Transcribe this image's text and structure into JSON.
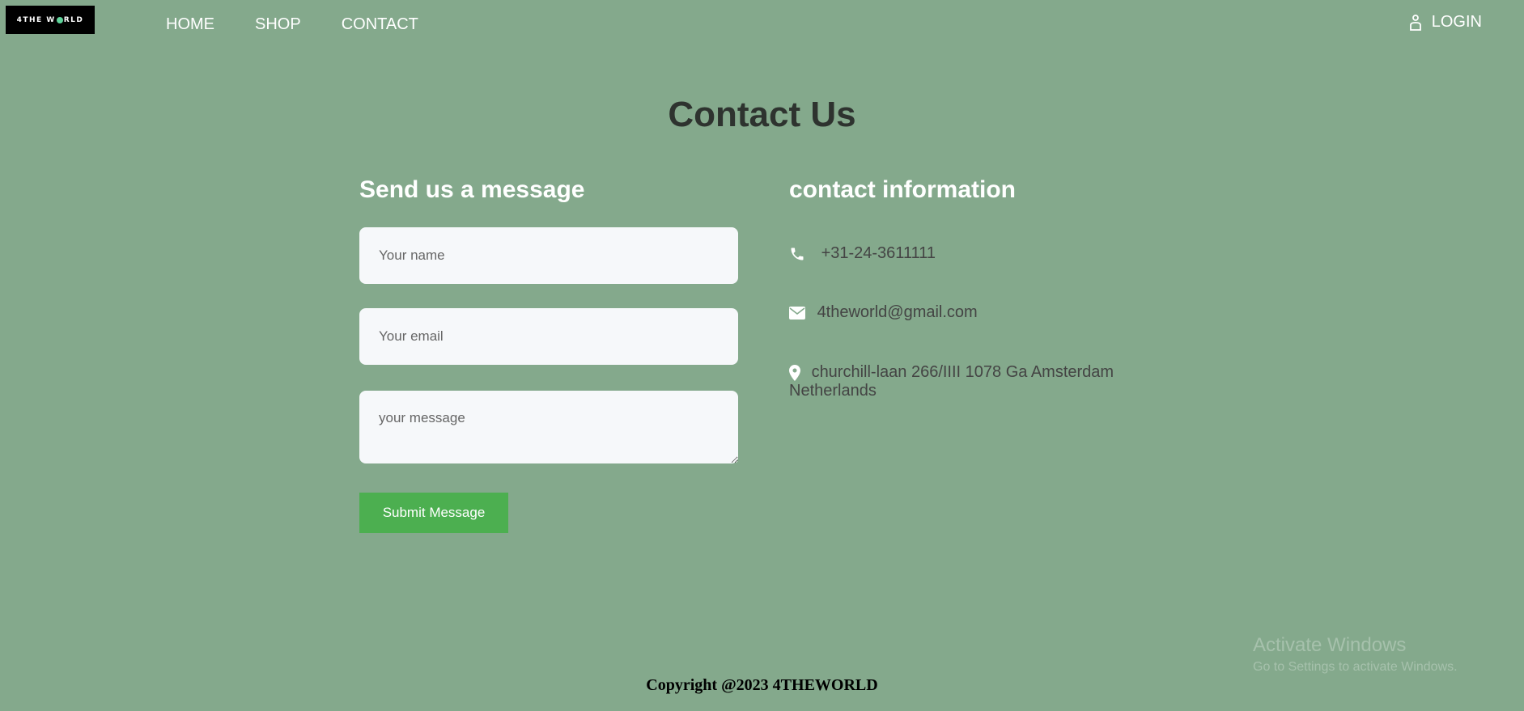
{
  "header": {
    "logo_text_a": "4THE W",
    "logo_text_b": "RLD",
    "nav": [
      "HOME",
      "SHOP",
      "CONTACT"
    ],
    "login": "LOGIN"
  },
  "page_title": "Contact Us",
  "form": {
    "heading": "Send us a message",
    "name_placeholder": "Your name",
    "email_placeholder": "Your email",
    "message_placeholder": "your message",
    "submit_label": "Submit Message"
  },
  "contact": {
    "heading": "contact information",
    "phone": "+31-24-3611111",
    "email": "4theworld@gmail.com",
    "address": "churchill-laan 266/IIII 1078 Ga Amsterdam Netherlands"
  },
  "footer": {
    "copyright": "Copyright @2023 4THEWORLD"
  },
  "watermark": {
    "line1": "Activate Windows",
    "line2": "Go to Settings to activate Windows."
  },
  "colors": {
    "background": "#84a98c",
    "submit": "#4caf50",
    "title": "#2e332f"
  },
  "icons": [
    "user-icon",
    "phone-icon",
    "envelope-icon",
    "location-pin-icon"
  ]
}
